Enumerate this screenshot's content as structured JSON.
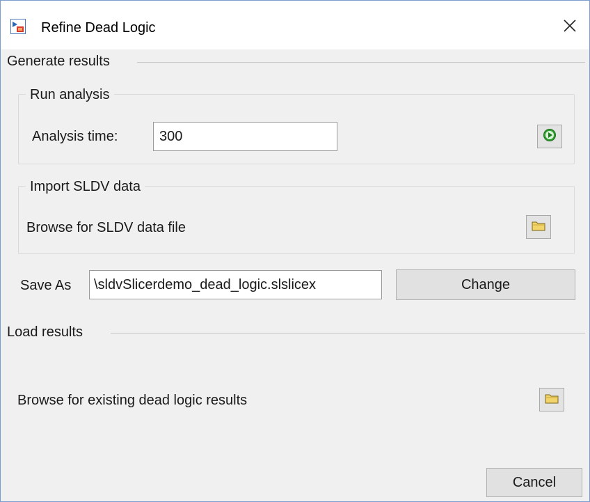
{
  "window": {
    "title": "Refine Dead Logic"
  },
  "icons": {
    "app": "model-slicer-icon",
    "close": "close-icon",
    "run": "play-icon",
    "browse": "folder-icon"
  },
  "generate": {
    "label": "Generate results",
    "run_analysis": {
      "label": "Run analysis",
      "time_label": "Analysis time:",
      "time_value": "300"
    },
    "import_sldv": {
      "label": "Import SLDV data",
      "browse_label": "Browse for SLDV data file"
    },
    "save_as": {
      "label": "Save As",
      "value": "\\sldvSlicerdemo_dead_logic.slslicex",
      "change_label": "Change"
    }
  },
  "load": {
    "label": "Load results",
    "browse_label": "Browse for existing dead logic results"
  },
  "footer": {
    "cancel_label": "Cancel"
  },
  "colors": {
    "play_green": "#2e9e2e",
    "folder_yellow": "#f2d46a",
    "accent_border": "#7a9ccf"
  }
}
